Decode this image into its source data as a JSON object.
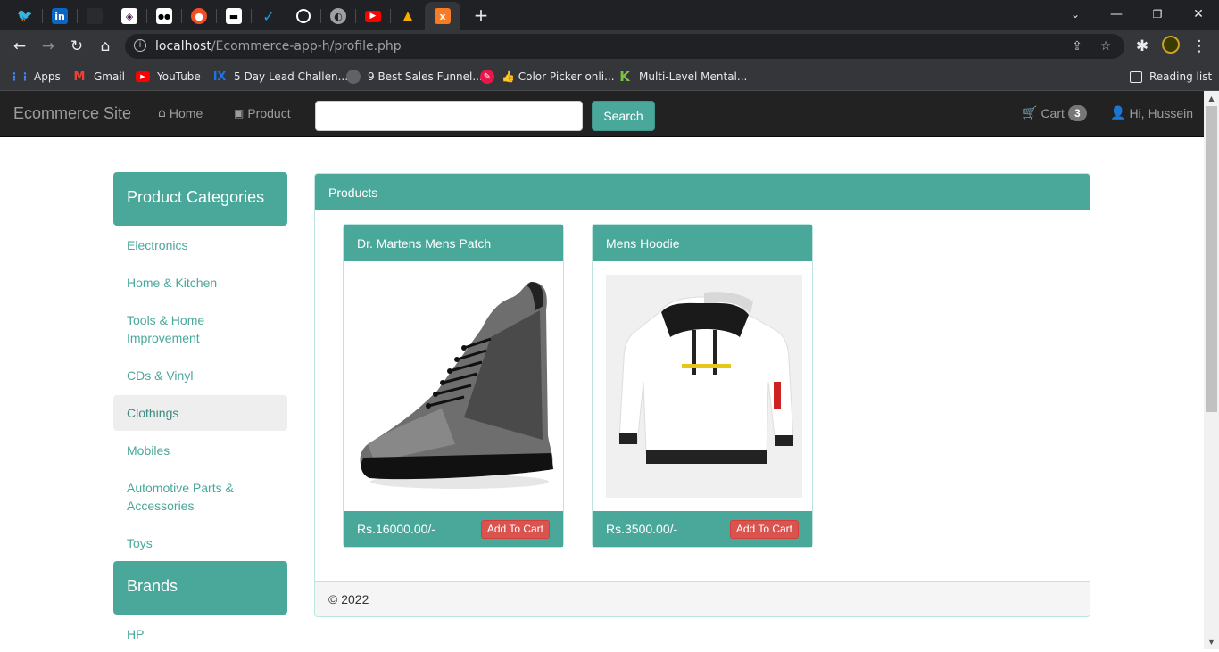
{
  "browser": {
    "url_host": "localhost",
    "url_path": "/Ecommerce-app-h/profile.php",
    "tabs": [
      {
        "icon": "twitter-icon",
        "glyph": "🐦",
        "color": "#1d9bf0"
      },
      {
        "icon": "linkedin-icon",
        "glyph": "in",
        "color": "#0a66c2"
      },
      {
        "icon": "page-icon",
        "glyph": "◼",
        "color": "#2b2b2b"
      },
      {
        "icon": "slack-icon",
        "glyph": "◈",
        "color": "#ffffff"
      },
      {
        "icon": "medium-icon",
        "glyph": "●●",
        "color": "#000000"
      },
      {
        "icon": "app-icon",
        "glyph": "●",
        "color": "#f25022"
      },
      {
        "icon": "page-icon",
        "glyph": "▬",
        "color": "#ffffff"
      },
      {
        "icon": "app-icon",
        "glyph": "✓",
        "color": "#1d9bf0"
      },
      {
        "icon": "github-icon",
        "glyph": "◯",
        "color": "#ffffff"
      },
      {
        "icon": "globe-icon",
        "glyph": "◐",
        "color": "#9aa0a6"
      },
      {
        "icon": "youtube-icon",
        "glyph": "▶",
        "color": "#ff0000"
      },
      {
        "icon": "app-icon",
        "glyph": "▲",
        "color": "#f9ab00"
      },
      {
        "icon": "xampp-icon",
        "glyph": "x",
        "color": "#fb7a24"
      }
    ],
    "bookmarks": [
      {
        "label": "Apps",
        "icon": "apps-icon",
        "glyph": "⋮⋮",
        "color": "#4285f4"
      },
      {
        "label": "Gmail",
        "icon": "gmail-icon",
        "glyph": "M",
        "color": "#ea4335"
      },
      {
        "label": "YouTube",
        "icon": "youtube-icon",
        "glyph": "▶",
        "color": "#ff0000"
      },
      {
        "label": "5 Day Lead Challen...",
        "icon": "bookmark-icon",
        "glyph": "Ⅸ",
        "color": "#1a73e8"
      },
      {
        "label": "9 Best Sales Funnel...",
        "icon": "bookmark-icon",
        "glyph": "◎",
        "color": "#5f6368"
      },
      {
        "label": "👍 Color Picker onli...",
        "icon": "color-picker-icon",
        "glyph": "✎",
        "color": "#e8174a"
      },
      {
        "label": "Multi-Level Mental...",
        "icon": "bookmark-icon",
        "glyph": "K",
        "color": "#7cc242"
      }
    ],
    "reading_list": "Reading list"
  },
  "navbar": {
    "brand": "Ecommerce Site",
    "home": "Home",
    "product": "Product",
    "search_value": "",
    "search_button": "Search",
    "cart_label": "Cart",
    "cart_count": "3",
    "user_greeting": "Hi, Hussein"
  },
  "sidebar": {
    "categories_title": "Product Categories",
    "categories": [
      {
        "label": "Electronics",
        "active": false
      },
      {
        "label": "Home & Kitchen",
        "active": false
      },
      {
        "label": "Tools & Home Improvement",
        "active": false
      },
      {
        "label": "CDs & Vinyl",
        "active": false
      },
      {
        "label": "Clothings",
        "active": true
      },
      {
        "label": "Mobiles",
        "active": false
      },
      {
        "label": "Automotive Parts & Accessories",
        "active": false
      },
      {
        "label": "Toys",
        "active": false
      }
    ],
    "brands_title": "Brands",
    "brands": [
      "HP"
    ]
  },
  "products_panel": {
    "title": "Products",
    "footer": "© 2022",
    "items": [
      {
        "name": "Dr. Martens Mens Patch",
        "price": "Rs.16000.00/-",
        "button": "Add To Cart"
      },
      {
        "name": "Mens Hoodie",
        "price": "Rs.3500.00/-",
        "button": "Add To Cart"
      }
    ]
  },
  "colors": {
    "accent": "#4aa89b",
    "navbar_bg": "#222222",
    "danger": "#d9534f"
  }
}
